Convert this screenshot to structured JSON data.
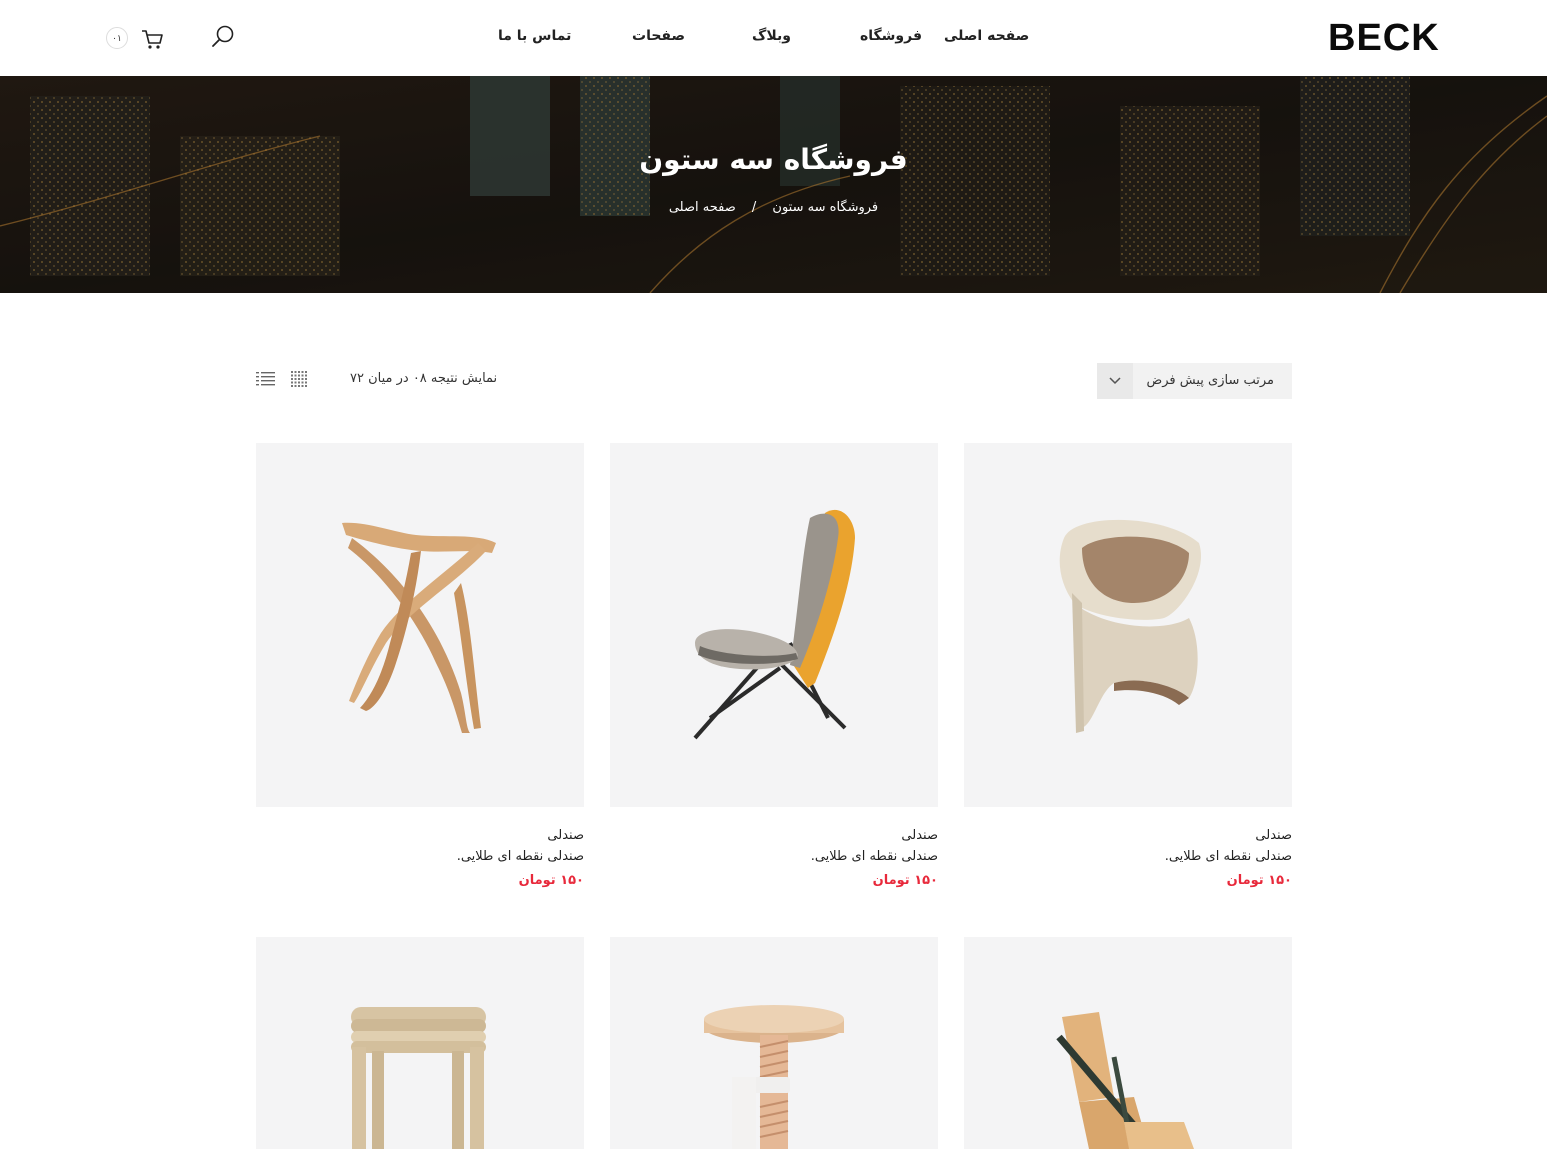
{
  "header": {
    "logo": "BECK",
    "nav": [
      "صفحه اصلی",
      "فروشگاه",
      "وبلاگ",
      "صفحات",
      "تماس با ما"
    ],
    "cart_count": "۰۱",
    "icons": [
      "search-icon",
      "cart-icon"
    ]
  },
  "banner": {
    "title": "فروشگاه سه ستون",
    "breadcrumb": [
      "صفحه اصلی",
      "/",
      "فروشگاه سه ستون"
    ]
  },
  "toolbar": {
    "result_text": "نمایش نتیجه ۰۸ در میان ۷۲",
    "sort_label": "مرتب سازی پیش فرض",
    "view_icons": [
      "grid-view-icon",
      "list-view-icon"
    ]
  },
  "products": [
    {
      "category": "صندلی",
      "name": "صندلی نقطه ای طلایی.",
      "price": "۱۵۰ تومان"
    },
    {
      "category": "صندلی",
      "name": "صندلی نقطه ای طلایی.",
      "price": "۱۵۰ تومان"
    },
    {
      "category": "صندلی",
      "name": "صندلی نقطه ای طلایی.",
      "price": "۱۵۰ تومان"
    },
    {
      "category": "",
      "name": "",
      "price": ""
    },
    {
      "category": "",
      "name": "",
      "price": ""
    },
    {
      "category": "",
      "name": "",
      "price": ""
    }
  ],
  "colors": {
    "price": "#e8293b",
    "card_bg": "#f4f4f5",
    "sort_bg": "#f2f2f2"
  }
}
